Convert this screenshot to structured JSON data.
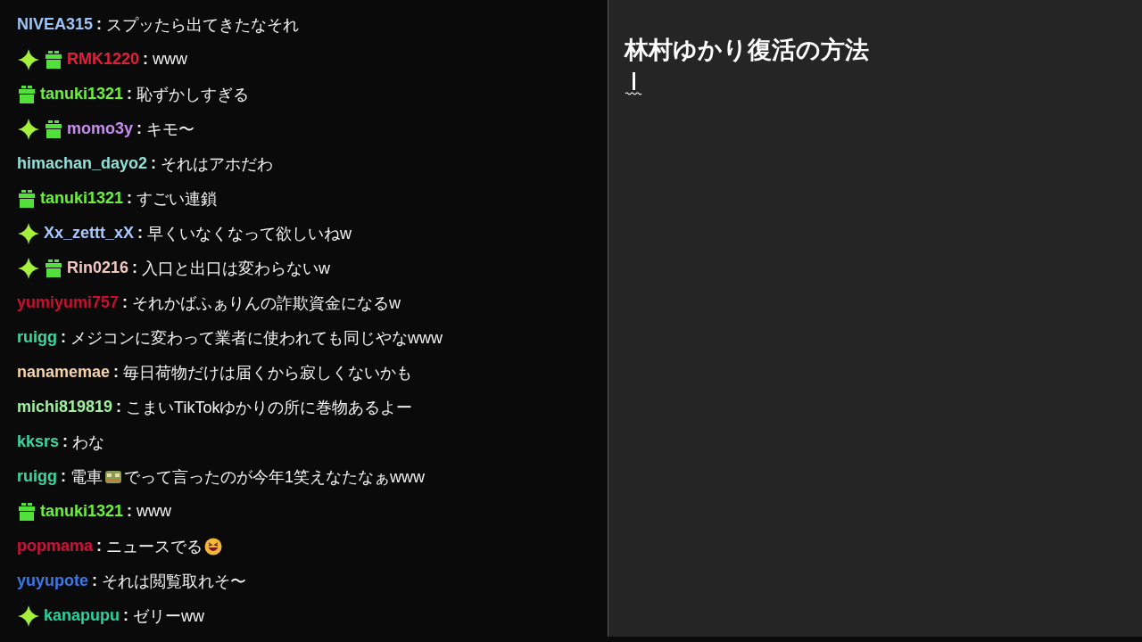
{
  "chat": {
    "messages": [
      {
        "user": "NIVEA315",
        "separator": ":",
        "color": "#9ec3f5",
        "parts": [
          {
            "kind": "text",
            "text": "スプッたら出てきたなそれ"
          }
        ]
      },
      {
        "badges": [
          {
            "kind": "sparkle"
          },
          {
            "kind": "gift"
          }
        ],
        "user": "RMK1220",
        "separator": ":",
        "color": "#e0203a",
        "parts": [
          {
            "kind": "text",
            "text": "www"
          }
        ]
      },
      {
        "badges": [
          {
            "kind": "gift"
          }
        ],
        "user": "tanuki1321",
        "separator": ":",
        "color": "#6bf03c",
        "parts": [
          {
            "kind": "text",
            "text": "恥ずかしすぎる"
          }
        ]
      },
      {
        "badges": [
          {
            "kind": "sparkle"
          },
          {
            "kind": "gift"
          }
        ],
        "user": "momo3y",
        "separator": ":",
        "color": "#c88cf0",
        "parts": [
          {
            "kind": "text",
            "text": "キモ〜"
          }
        ]
      },
      {
        "user": "himachan_dayo2",
        "separator": ":",
        "color": "#8fe0d8",
        "parts": [
          {
            "kind": "text",
            "text": "それはアホだわ"
          }
        ]
      },
      {
        "badges": [
          {
            "kind": "gift"
          }
        ],
        "user": "tanuki1321",
        "separator": ":",
        "color": "#6bf03c",
        "parts": [
          {
            "kind": "text",
            "text": "すごい連鎖"
          }
        ]
      },
      {
        "badges": [
          {
            "kind": "sparkle"
          }
        ],
        "user": "Xx_zettt_xX",
        "separator": ":",
        "color": "#a8c8ff",
        "parts": [
          {
            "kind": "text",
            "text": "早くいなくなって欲しいねw"
          }
        ]
      },
      {
        "badges": [
          {
            "kind": "sparkle"
          },
          {
            "kind": "gift"
          }
        ],
        "user": "Rin0216",
        "separator": ":",
        "color": "#f0c8c0",
        "parts": [
          {
            "kind": "text",
            "text": "入口と出口は変わらないw"
          }
        ]
      },
      {
        "user": "yumiyumi757",
        "separator": ":",
        "color": "#c8102e",
        "parts": [
          {
            "kind": "text",
            "text": "それかばふぁりんの詐欺資金になるw"
          }
        ]
      },
      {
        "user": "ruigg",
        "separator": ":",
        "color": "#3cd7a0",
        "parts": [
          {
            "kind": "text",
            "text": "メジコンに変わって業者に使われても同じやなwww"
          }
        ]
      },
      {
        "user": "nanamemae",
        "separator": ":",
        "color": "#f5d2a8",
        "parts": [
          {
            "kind": "text",
            "text": "毎日荷物だけは届くから寂しくないかも"
          }
        ]
      },
      {
        "user": "michi819819",
        "separator": ":",
        "color": "#a0f0a0",
        "parts": [
          {
            "kind": "text",
            "text": "こまいTikTokゆかりの所に巻物あるよー"
          }
        ]
      },
      {
        "user": "kksrs",
        "separator": ":",
        "color": "#3cd7a0",
        "parts": [
          {
            "kind": "text",
            "text": "わな"
          }
        ]
      },
      {
        "user": "ruigg",
        "separator": ":",
        "color": "#3cd7a0",
        "parts": [
          {
            "kind": "text",
            "text": "電車"
          },
          {
            "kind": "train"
          },
          {
            "kind": "text",
            "text": "でって言ったのが今年1笑えなたなぁwww"
          }
        ]
      },
      {
        "badges": [
          {
            "kind": "gift"
          }
        ],
        "user": "tanuki1321",
        "separator": ":",
        "color": "#6bf03c",
        "parts": [
          {
            "kind": "text",
            "text": "www"
          }
        ]
      },
      {
        "user": "popmama",
        "separator": ":",
        "color": "#d0103a",
        "parts": [
          {
            "kind": "text",
            "text": "ニュースでる"
          },
          {
            "kind": "laughing"
          }
        ]
      },
      {
        "user": "yuyupote",
        "separator": ":",
        "color": "#3a78e8",
        "parts": [
          {
            "kind": "text",
            "text": "それは閲覧取れそ〜"
          }
        ]
      },
      {
        "badges": [
          {
            "kind": "sparkle"
          }
        ],
        "user": "kanapupu",
        "separator": ":",
        "color": "#2ad0a0",
        "parts": [
          {
            "kind": "text",
            "text": "ゼリーww"
          }
        ]
      }
    ]
  },
  "editor": {
    "title": "林村ゆかり復活の方法",
    "composing": true
  }
}
